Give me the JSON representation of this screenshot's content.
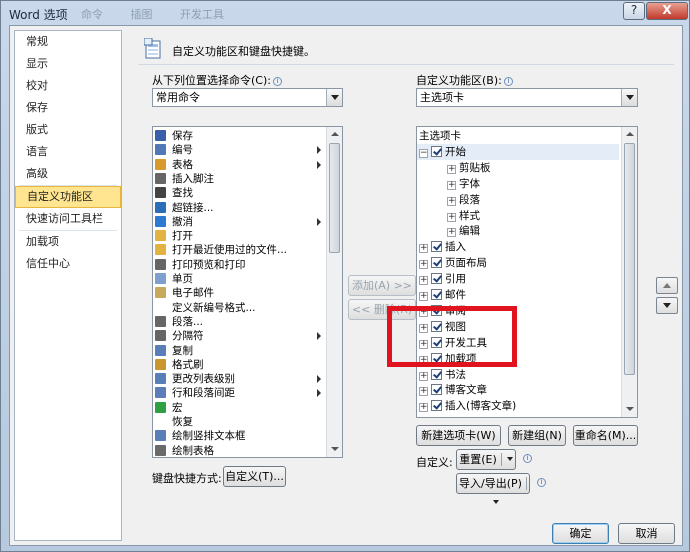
{
  "window": {
    "title": "Word 选项",
    "blurred_tabs": [
      "命令",
      "插图",
      "开发工具"
    ],
    "help_glyph": "?",
    "close_glyph": "X"
  },
  "nav": {
    "items": [
      "常规",
      "显示",
      "校对",
      "保存",
      "版式",
      "语言",
      "高级",
      "自定义功能区",
      "快速访问工具栏",
      "加载项",
      "信任中心"
    ],
    "selected": "自定义功能区"
  },
  "header": {
    "icon": "customize-ribbon-icon",
    "text": "自定义功能区和键盘快捷键。"
  },
  "left_panel": {
    "label": "从下列位置选择命令(C):",
    "combo_value": "常用命令",
    "commands": [
      {
        "label": "保存",
        "icon": "save-icon",
        "sub": false
      },
      {
        "label": "编号",
        "icon": "numbering-icon",
        "sub": true
      },
      {
        "label": "表格",
        "icon": "table-icon",
        "sub": true
      },
      {
        "label": "插入脚注",
        "icon": "footnote-icon",
        "sub": false
      },
      {
        "label": "查找",
        "icon": "find-icon",
        "sub": false
      },
      {
        "label": "超链接...",
        "icon": "hyperlink-icon",
        "sub": false
      },
      {
        "label": "撤消",
        "icon": "undo-icon",
        "sub": true
      },
      {
        "label": "打开",
        "icon": "open-icon",
        "sub": false
      },
      {
        "label": "打开最近使用过的文件...",
        "icon": "recent-files-icon",
        "sub": false
      },
      {
        "label": "打印预览和打印",
        "icon": "print-preview-icon",
        "sub": false
      },
      {
        "label": "单页",
        "icon": "single-page-icon",
        "sub": false
      },
      {
        "label": "电子邮件",
        "icon": "email-icon",
        "sub": false
      },
      {
        "label": "定义新编号格式...",
        "icon": "blank-icon",
        "sub": false
      },
      {
        "label": "段落...",
        "icon": "paragraph-icon",
        "sub": false
      },
      {
        "label": "分隔符",
        "icon": "breaks-icon",
        "sub": true
      },
      {
        "label": "复制",
        "icon": "copy-icon",
        "sub": false
      },
      {
        "label": "格式刷",
        "icon": "format-painter-icon",
        "sub": false
      },
      {
        "label": "更改列表级别",
        "icon": "list-level-icon",
        "sub": true
      },
      {
        "label": "行和段落间距",
        "icon": "line-spacing-icon",
        "sub": true
      },
      {
        "label": "宏",
        "icon": "macro-icon",
        "sub": false
      },
      {
        "label": "恢复",
        "icon": "blank-icon",
        "sub": false
      },
      {
        "label": "绘制竖排文本框",
        "icon": "vertical-textbox-icon",
        "sub": false
      },
      {
        "label": "绘制表格",
        "icon": "draw-table-icon",
        "sub": false
      }
    ],
    "keyboard_label": "键盘快捷方式:",
    "keyboard_button": "自定义(T)..."
  },
  "middle": {
    "add_button": "添加(A) >>",
    "remove_button": "<< 删除(R)"
  },
  "right_panel": {
    "label": "自定义功能区(B):",
    "combo_value": "主选项卡",
    "tree": [
      {
        "label": "主选项卡",
        "level": 0,
        "expander": "",
        "checkbox": false
      },
      {
        "label": "开始",
        "level": 1,
        "expander": "−",
        "checkbox": true
      },
      {
        "label": "剪贴板",
        "level": 2,
        "expander": "+",
        "checkbox": false
      },
      {
        "label": "字体",
        "level": 2,
        "expander": "+",
        "checkbox": false
      },
      {
        "label": "段落",
        "level": 2,
        "expander": "+",
        "checkbox": false
      },
      {
        "label": "样式",
        "level": 2,
        "expander": "+",
        "checkbox": false
      },
      {
        "label": "编辑",
        "level": 2,
        "expander": "+",
        "checkbox": false
      },
      {
        "label": "插入",
        "level": 1,
        "expander": "+",
        "checkbox": true
      },
      {
        "label": "页面布局",
        "level": 1,
        "expander": "+",
        "checkbox": true
      },
      {
        "label": "引用",
        "level": 1,
        "expander": "+",
        "checkbox": true
      },
      {
        "label": "邮件",
        "level": 1,
        "expander": "+",
        "checkbox": true
      },
      {
        "label": "审阅",
        "level": 1,
        "expander": "+",
        "checkbox": true
      },
      {
        "label": "视图",
        "level": 1,
        "expander": "+",
        "checkbox": true
      },
      {
        "label": "开发工具",
        "level": 1,
        "expander": "+",
        "checkbox": true
      },
      {
        "label": "加载项",
        "level": 1,
        "expander": "+",
        "checkbox": true
      },
      {
        "label": "书法",
        "level": 1,
        "expander": "+",
        "checkbox": true
      },
      {
        "label": "博客文章",
        "level": 1,
        "expander": "+",
        "checkbox": true
      },
      {
        "label": "插入(博客文章)",
        "level": 1,
        "expander": "+",
        "checkbox": true
      }
    ],
    "new_tab_button": "新建选项卡(W)",
    "new_group_button": "新建组(N)",
    "rename_button": "重命名(M)...",
    "customize_label": "自定义:",
    "reset_button": "重置(E)",
    "import_export_button": "导入/导出(P)"
  },
  "footer": {
    "ok_button": "确定",
    "cancel_button": "取消"
  },
  "colors": {
    "highlight_box": "#e0141e",
    "nav_selected": "#ffe58f"
  }
}
